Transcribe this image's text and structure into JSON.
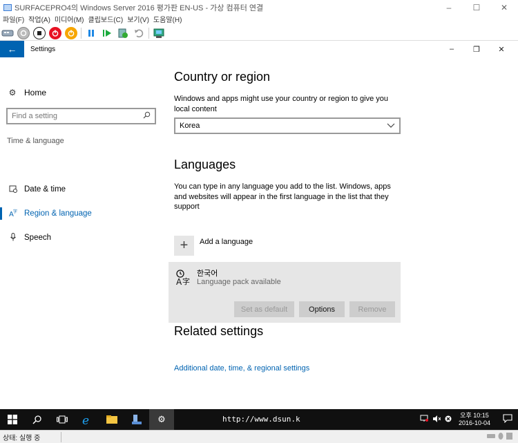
{
  "host": {
    "title": "SURFACEPRO4의 Windows Server 2016 평가판 EN-US - 가상 컴퓨터 연결",
    "window_controls": [
      "–",
      "☐",
      "✕"
    ],
    "menu": [
      "파일(F)",
      "작업(A)",
      "미디어(M)",
      "클립보드(C)",
      "보기(V)",
      "도움말(H)"
    ],
    "toolbar_icons": [
      "ctrl-alt-del-icon",
      "start-icon",
      "turn-off-icon",
      "shutdown-icon",
      "save-icon",
      "pause-icon",
      "resume-icon",
      "checkpoint-icon",
      "revert-icon",
      "enhanced-session-icon"
    ],
    "colors": {
      "blue": "#0063b1",
      "red": "#e81123",
      "orange": "#f7a600",
      "green": "#1aaa3c"
    },
    "status": "상태: 실행 중"
  },
  "settings": {
    "title": "Settings",
    "back_glyph": "←",
    "controls": [
      "–",
      "❐",
      "✕"
    ],
    "sidebar": {
      "home": "Home",
      "search_placeholder": "Find a setting",
      "section": "Time & language",
      "items": [
        {
          "label": "Date & time",
          "icon": "date-time-icon"
        },
        {
          "label": "Region & language",
          "icon": "region-language-icon",
          "active": true
        },
        {
          "label": "Speech",
          "icon": "microphone-icon"
        }
      ]
    },
    "country": {
      "heading": "Country or region",
      "description": "Windows and apps might use your country or region to give you local content",
      "selected": "Korea"
    },
    "languages": {
      "heading": "Languages",
      "description": "You can type in any language you add to the list. Windows, apps and websites will appear in the first language in the list that they support",
      "add_label": "Add a language",
      "language_name": "한국어",
      "language_status": "Language pack available",
      "buttons": {
        "set_default": "Set as default",
        "options": "Options",
        "remove": "Remove"
      }
    },
    "related": {
      "heading": "Related settings",
      "link": "Additional date, time, & regional settings"
    }
  },
  "taskbar": {
    "watermark": "http://www.dsun.k",
    "time": "오후 10:15",
    "date": "2016-10-04"
  }
}
